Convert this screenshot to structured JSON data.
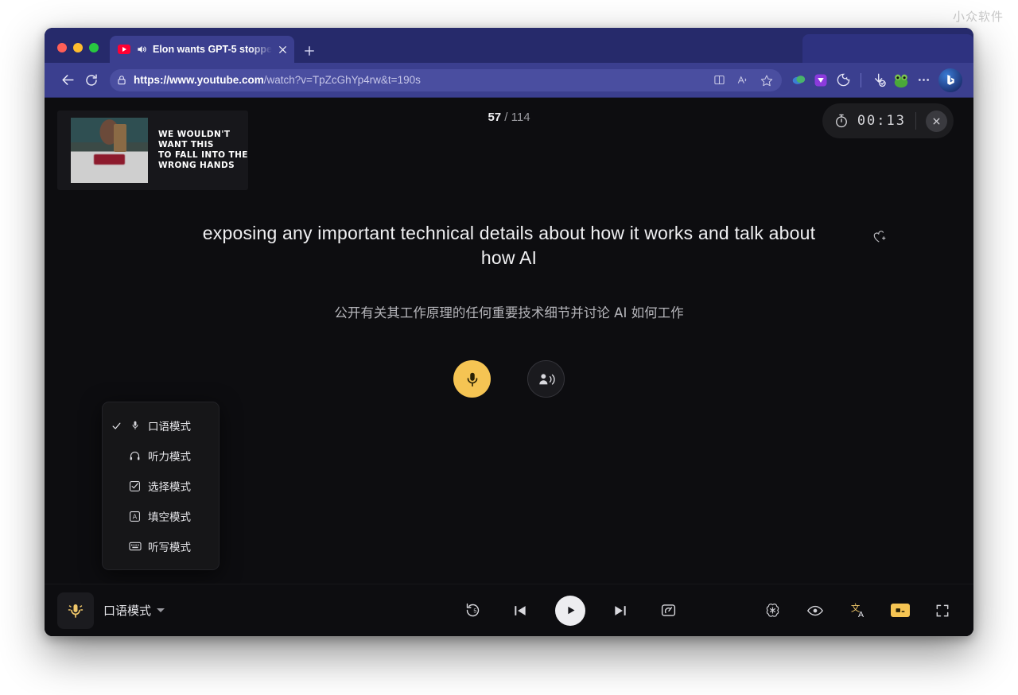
{
  "watermark": "小众软件",
  "browser": {
    "tab": {
      "title": "Elon wants GPT-5 stoppe",
      "favicon_icon": "youtube-icon",
      "audio_icon": "speaker-icon",
      "close_icon": "close-icon"
    },
    "new_tab_icon": "plus-icon",
    "back_icon": "arrow-left-icon",
    "reload_icon": "reload-icon",
    "lock_icon": "lock-icon",
    "url": {
      "scheme_host": "https://www.youtube.com",
      "path": "/watch?v=TpZcGhYp4rw&t=190s",
      "full": "https://www.youtube.com/watch?v=TpZcGhYp4rw&t=190s"
    },
    "toolbar_icons": [
      "split-screen-icon",
      "read-aloud-icon",
      "favorites-add-icon",
      "collections-extension-icon",
      "purple-extension-icon",
      "cookie-extension-icon",
      "downloads-icon",
      "frog-extension-icon",
      "more-options-icon",
      "copilot-icon"
    ]
  },
  "player": {
    "thumbnail": {
      "caption_lines": [
        "WE WOULDN'T",
        "WANT THIS",
        "TO FALL INTO THE",
        "WRONG HANDS"
      ]
    },
    "counter": {
      "current": "57",
      "separator": "/",
      "total": "114",
      "text": "57 / 114"
    },
    "timer": {
      "clock_icon": "stopwatch-icon",
      "value": "00:13",
      "close_icon": "close-circle-icon"
    },
    "subtitle_en": "exposing any important technical details about how it works and talk about how AI",
    "subtitle_zh": "公开有关其工作原理的任何重要技术细节并讨论 AI 如何工作",
    "favorite_icon": "heart-plus-icon",
    "mic_button_icon": "microphone-icon",
    "speak_detect_icon": "person-speaking-icon",
    "accent_color": "#f5c453"
  },
  "menu": {
    "items": [
      {
        "label": "口语模式",
        "icon": "microphone-icon",
        "checked": true
      },
      {
        "label": "听力模式",
        "icon": "headphones-icon",
        "checked": false
      },
      {
        "label": "选择模式",
        "icon": "multiple-choice-icon",
        "checked": false
      },
      {
        "label": "填空模式",
        "icon": "fill-blank-icon",
        "checked": false
      },
      {
        "label": "听写模式",
        "icon": "dictation-keyboard-icon",
        "checked": false
      }
    ],
    "check_icon": "checkmark-icon"
  },
  "bottom_bar": {
    "mode_button_icon": "microphone-active-icon",
    "mode_label": "口语模式",
    "caret_icon": "chevron-down-icon",
    "controls": [
      {
        "name": "replay-icon"
      },
      {
        "name": "previous-sentence-icon"
      },
      {
        "name": "play-icon"
      },
      {
        "name": "next-sentence-icon"
      },
      {
        "name": "playback-speed-icon"
      }
    ],
    "right_icons": [
      {
        "name": "openai-icon"
      },
      {
        "name": "eye-icon"
      },
      {
        "name": "translate-icon"
      },
      {
        "name": "captions-icon"
      },
      {
        "name": "fullscreen-icon"
      }
    ]
  }
}
